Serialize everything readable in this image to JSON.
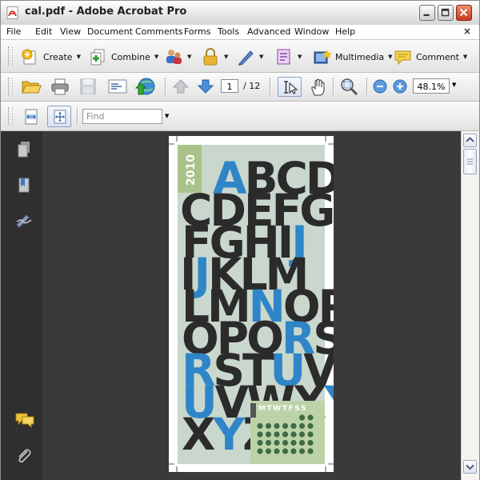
{
  "window": {
    "title": "cal.pdf - Adobe Acrobat Pro"
  },
  "menu": [
    "File",
    "Edit",
    "View",
    "Document",
    "Comments",
    "Forms",
    "Tools",
    "Advanced",
    "Window",
    "Help"
  ],
  "menu_close": "×",
  "toolbar1": {
    "create": "Create",
    "combine": "Combine",
    "multimedia": "Multimedia",
    "comment": "Comment"
  },
  "navigation": {
    "current_page": "1",
    "total_pages": "/ 12",
    "zoom": "48.1%"
  },
  "find": {
    "placeholder": "Find"
  },
  "document": {
    "year": "2010",
    "alphabet_rows": [
      "ABCD",
      "CDEFG",
      "FGHIJ",
      "IJKLM",
      "LMNOP",
      "OPQRS",
      "RSTUV",
      "UVWXY",
      "XYZ"
    ],
    "weekday_header": "MTWTFSS",
    "highlight_color": "#2e86c8",
    "background_color": "#c9d7cc",
    "year_panel_color": "#a9c28a",
    "calendar_panel_color": "#bcd3a8"
  }
}
